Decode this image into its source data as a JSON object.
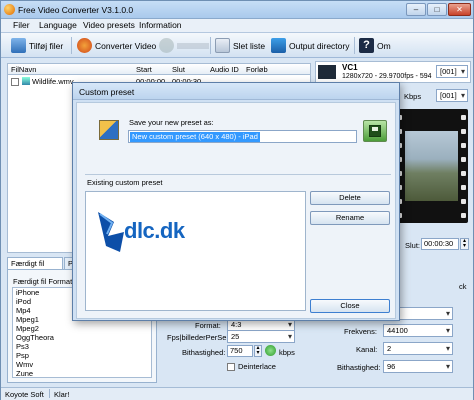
{
  "app": {
    "title": "Free Video Converter V3.1.0.0"
  },
  "window_buttons": {
    "minimize": "–",
    "maximize": "□",
    "close": "✕"
  },
  "menu": [
    "Filer",
    "Language",
    "Video presets",
    "Information"
  ],
  "toolbar": {
    "add_files": "Tilføj filer",
    "convert": "Converter Video",
    "delete": "Slet liste",
    "output": "Output directory",
    "about": "Om"
  },
  "file_list": {
    "headers": [
      "FilNavn",
      "Start",
      "Slut",
      "Audio ID",
      "Forløb"
    ],
    "rows": [
      {
        "name": "Wildlife.wmv",
        "start": "00:00:00",
        "end": "00:00:30"
      }
    ]
  },
  "video_codec": {
    "name": "VC1",
    "info": "1280x720 - 29.9700fps - 594",
    "stream": "[001]"
  },
  "audio_codec": {
    "bitrate": "Kbps",
    "stream": "[001]"
  },
  "slut": {
    "label": "Slut:",
    "value": "00:00:30"
  },
  "bottom_tabs": [
    "Færdigt fil Format",
    "Pre"
  ],
  "format": {
    "label": "Færdigt fil Format:",
    "items": [
      "iPhone",
      "iPod",
      "Mp4",
      "Mpeg1",
      "Mpeg2",
      "OggTheora",
      "Ps3",
      "Psp",
      "Wmv",
      "Zune"
    ]
  },
  "video_settings": {
    "fps_label": "Fps|billederPerSe",
    "fps_value": "25",
    "bitrate_label": "Bithastighed:",
    "bitrate_value": "750",
    "bitrate_unit": "kbps",
    "deinterlace": "Deinterlace",
    "format_label": "Format:",
    "format_value": "4:3"
  },
  "audio_settings": {
    "freq_label": "Frekvens:",
    "freq_value": "44100",
    "channel_label": "Kanal:",
    "channel_value": "2",
    "bitrate_label": "Bithastighed:",
    "bitrate_value": "96",
    "track_label": "ck"
  },
  "status": {
    "company": "Koyote Soft",
    "state": "Klar!"
  },
  "dialog": {
    "title": "Custom preset",
    "save_label": "Save your new preset as:",
    "preset_name": "New custom preset (640 x 480) - iPad",
    "existing_label": "Existing custom preset",
    "delete": "Delete",
    "rename": "Rename",
    "close": "Close",
    "watermark": "dlc.dk"
  },
  "colors": {
    "accent": "#3d7fd1",
    "selection": "#3399ff",
    "watermark_blue": "#1565c0"
  }
}
